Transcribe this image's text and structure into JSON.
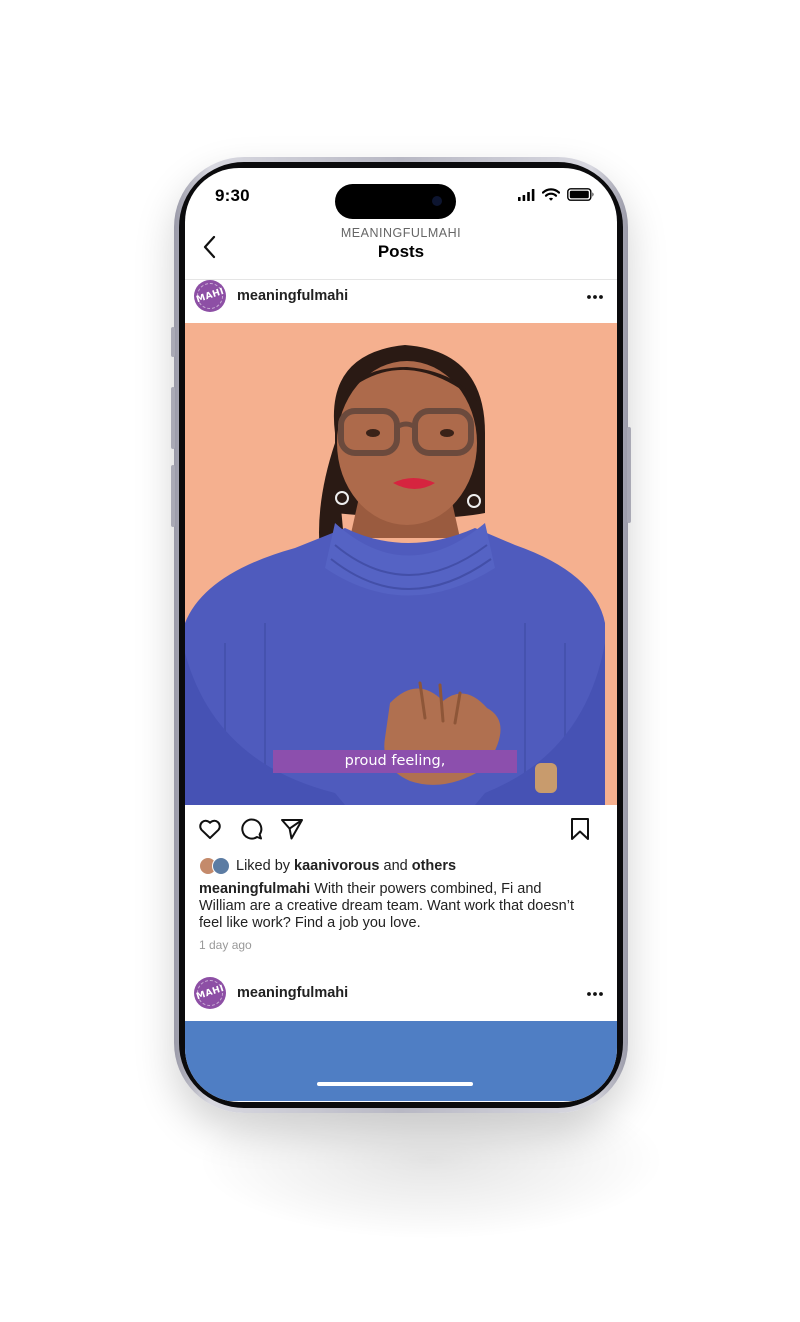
{
  "status_bar": {
    "time": "9:30",
    "icons": [
      "signal-icon",
      "wifi-icon",
      "battery-icon"
    ]
  },
  "header": {
    "account": "MEANINGFULMAHI",
    "title": "Posts",
    "back_icon": "chevron-left-icon"
  },
  "post": {
    "avatar_text": "MAHI",
    "username": "meaningfulmahi",
    "more_icon": "more-horizontal-icon",
    "video_caption": "proud feeling,",
    "actions": [
      "heart-icon",
      "comment-icon",
      "share-icon",
      "bookmark-icon"
    ],
    "liked_prefix": "Liked by",
    "liked_user": "kaanivorous",
    "liked_and": "and",
    "liked_others": "others",
    "caption_user": "meaningfulmahi",
    "caption": " With their powers combined, Fi and William are a creative dream team. Want work that doesn’t feel like work? Find a job you love.",
    "time_ago": "1 day ago"
  },
  "next_post": {
    "avatar_text": "MAHI",
    "username": "meaningfulmahi"
  },
  "colors": {
    "brand_purple": "#8c4fad",
    "photo_background": "#f5b08f",
    "sweater_blue": "#4f5bbd",
    "next_media": "#4f7ec4"
  }
}
